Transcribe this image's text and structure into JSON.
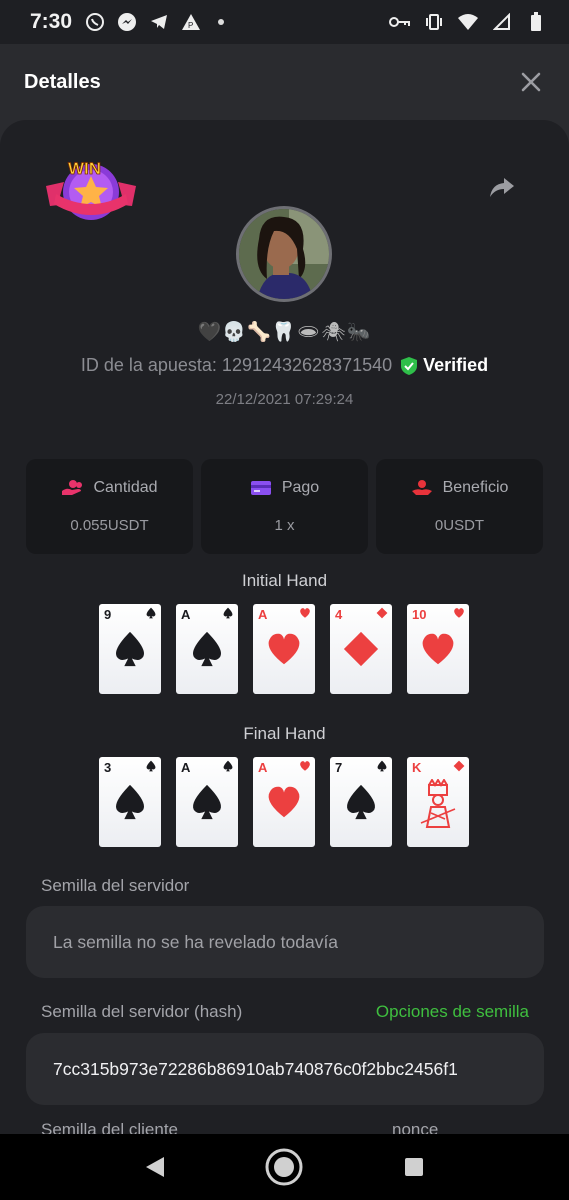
{
  "status_bar": {
    "time": "7:30",
    "left_icons": [
      "whatsapp-icon",
      "messenger-icon",
      "telegram-icon",
      "app-icon",
      "dot"
    ],
    "right_icons": [
      "key-icon",
      "vibrate-icon",
      "wifi-icon",
      "signal-icon",
      "battery-icon"
    ]
  },
  "header": {
    "title": "Detalles"
  },
  "bet": {
    "emoji_name": "🖤💀🦴🦷🕳🕷🐜",
    "bet_id_text": "ID de la apuesta: 12912432628371540",
    "verified_label": "Verified",
    "datetime": "22/12/2021 07:29:24"
  },
  "stats": [
    {
      "icon": "coins-hand-icon",
      "label": "Cantidad",
      "value": "0.055USDT"
    },
    {
      "icon": "card-icon",
      "label": "Pago",
      "value": "1 x"
    },
    {
      "icon": "profit-hand-icon",
      "label": "Beneficio",
      "value": "0USDT"
    }
  ],
  "initial_hand": {
    "title": "Initial Hand",
    "cards": [
      {
        "rank": "9",
        "suit": "spades"
      },
      {
        "rank": "A",
        "suit": "spades"
      },
      {
        "rank": "A",
        "suit": "hearts"
      },
      {
        "rank": "4",
        "suit": "diamonds"
      },
      {
        "rank": "10",
        "suit": "hearts"
      }
    ]
  },
  "final_hand": {
    "title": "Final Hand",
    "cards": [
      {
        "rank": "3",
        "suit": "spades"
      },
      {
        "rank": "A",
        "suit": "spades"
      },
      {
        "rank": "A",
        "suit": "hearts"
      },
      {
        "rank": "7",
        "suit": "spades"
      },
      {
        "rank": "K",
        "suit": "diamonds"
      }
    ]
  },
  "server_seed": {
    "label": "Semilla del servidor",
    "value": "La semilla no se ha revelado todavía"
  },
  "server_seed_hash": {
    "label": "Semilla del servidor (hash)",
    "link": "Opciones de semilla",
    "value": "7cc315b973e72286b86910ab740876c0f2bbc2456f1"
  },
  "client_seed": {
    "label": "Semilla del cliente",
    "nonce_label": "nonce"
  },
  "colors": {
    "red": "#ec4040",
    "black": "#1a1b1f",
    "green": "#3fbf3f"
  }
}
